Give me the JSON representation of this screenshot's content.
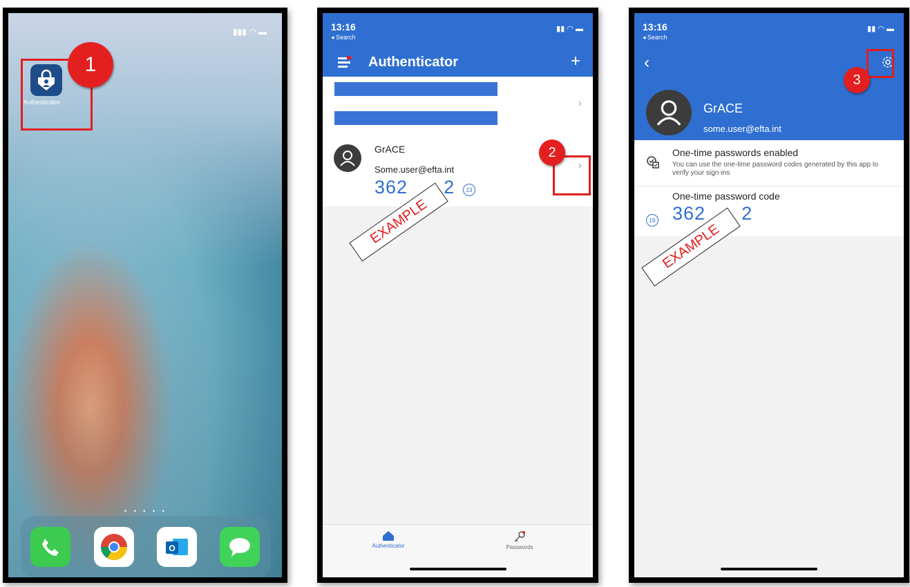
{
  "home": {
    "app_label": "Authenticator",
    "step": "1"
  },
  "list_screen": {
    "time": "13:16",
    "back_label": "◂ Search",
    "title": "Authenticator",
    "add_symbol": "+",
    "account": {
      "name": "GrACE",
      "email": "Some.user@efta.int",
      "code": "362",
      "code_tail": "2",
      "timer": "23"
    },
    "stamp": "EXAMPLE",
    "step": "2",
    "tabs": [
      {
        "label": "Authenticator",
        "icon": "home-icon",
        "active": true
      },
      {
        "label": "Passwords",
        "icon": "key-icon",
        "active": false
      }
    ]
  },
  "detail_screen": {
    "time": "13:16",
    "back_label": "◂ Search",
    "name": "GrACE",
    "email": "some.user@efta.int",
    "otp_enabled_title": "One-time passwords enabled",
    "otp_enabled_desc": "You can use the one-time password codes generated by this app to verify your sign-ins",
    "otp_code_title": "One-time password code",
    "code": "362",
    "code_tail": "2",
    "timer": "19",
    "stamp": "EXAMPLE",
    "step": "3"
  },
  "colors": {
    "accent_blue": "#2f6fd1",
    "marker_red": "#e01e1e"
  }
}
